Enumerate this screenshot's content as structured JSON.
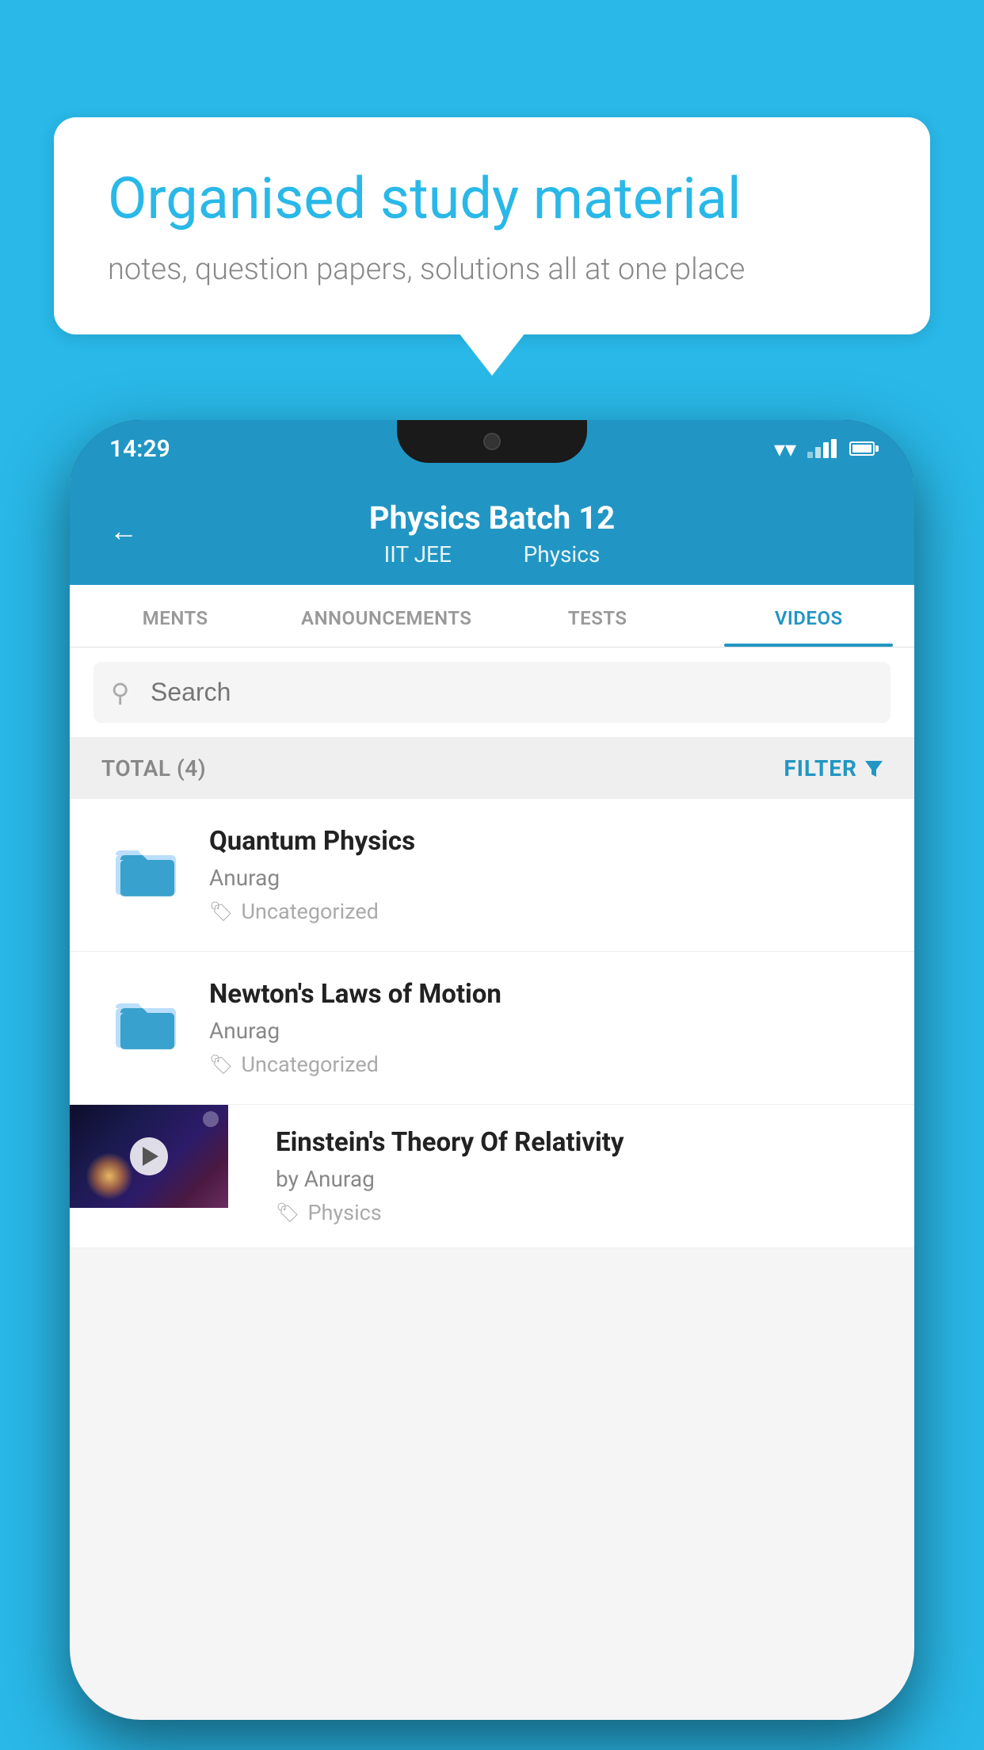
{
  "background": {
    "color": "#29B8E8"
  },
  "speech_bubble": {
    "title": "Organised study material",
    "subtitle": "notes, question papers, solutions all at one place"
  },
  "phone": {
    "status_bar": {
      "time": "14:29"
    },
    "app": {
      "top_bar": {
        "title": "Physics Batch 12",
        "subtitle1": "IIT JEE",
        "subtitle2": "Physics"
      },
      "tabs": [
        {
          "label": "MENTS",
          "active": false
        },
        {
          "label": "ANNOUNCEMENTS",
          "active": false
        },
        {
          "label": "TESTS",
          "active": false
        },
        {
          "label": "VIDEOS",
          "active": true
        }
      ],
      "search": {
        "placeholder": "Search"
      },
      "filter_bar": {
        "total_label": "TOTAL (4)",
        "filter_label": "FILTER"
      },
      "videos": [
        {
          "title": "Quantum Physics",
          "author": "Anurag",
          "tag": "Uncategorized",
          "type": "folder"
        },
        {
          "title": "Newton's Laws of Motion",
          "author": "Anurag",
          "tag": "Uncategorized",
          "type": "folder"
        },
        {
          "title": "Einstein's Theory Of Relativity",
          "author": "by Anurag",
          "tag": "Physics",
          "type": "video"
        }
      ]
    }
  }
}
